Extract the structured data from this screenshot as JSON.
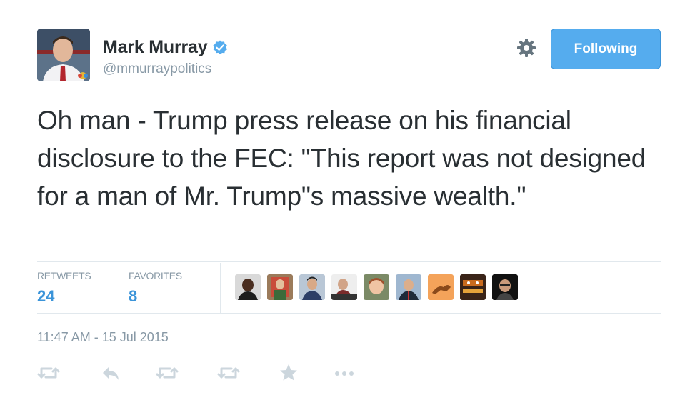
{
  "user": {
    "name": "Mark Murray",
    "handle": "@mmurraypolitics",
    "verified": true
  },
  "follow_button": {
    "label": "Following"
  },
  "tweet": {
    "text": "Oh man - Trump press release on his financial disclosure to the FEC: \"This report was not designed for a man of Mr. Trump\"s massive wealth.\""
  },
  "stats": {
    "retweets_label": "RETWEETS",
    "retweets_count": "24",
    "favorites_label": "FAVORITES",
    "favorites_count": "8"
  },
  "timestamp": "11:47 AM - 15 Jul 2015",
  "actions": [
    "reply-icon",
    "retweet-icon",
    "favorite-icon",
    "more-icon"
  ],
  "colors": {
    "accent": "#55acee",
    "link_blue": "#3b94d9",
    "text": "#292f33",
    "muted": "#8899a6",
    "border": "#e1e8ed"
  }
}
